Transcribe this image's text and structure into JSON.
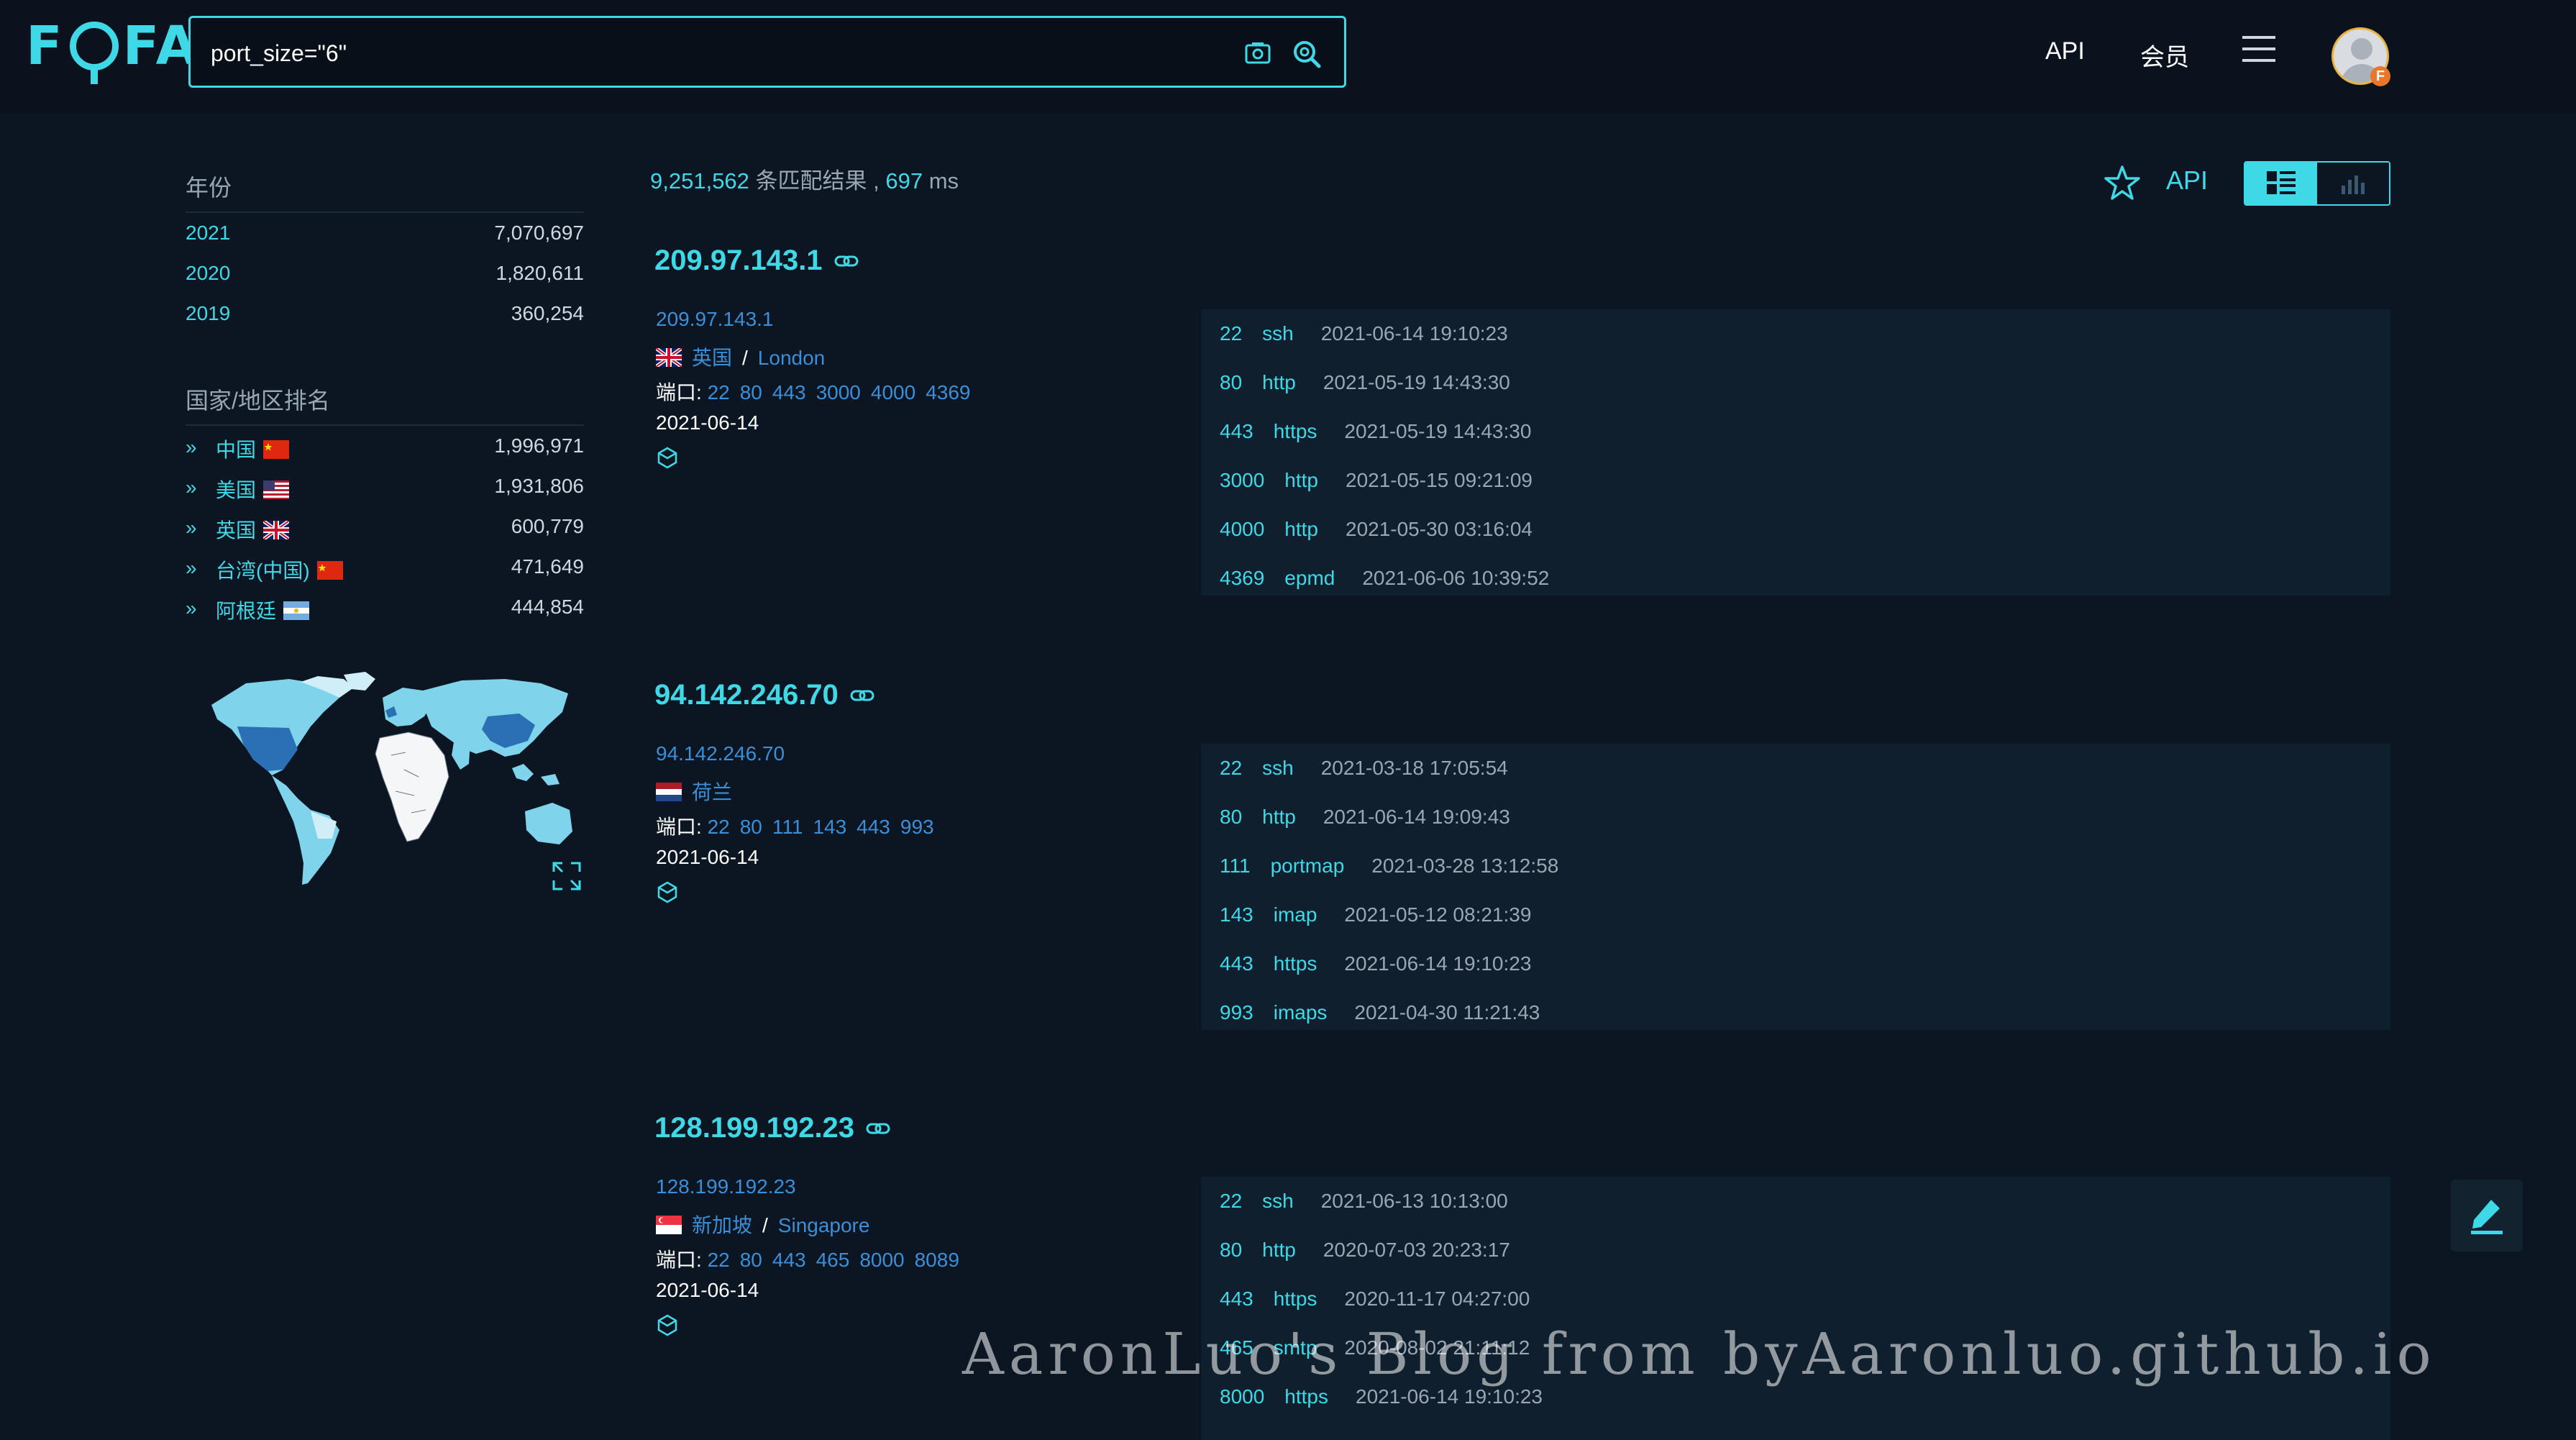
{
  "header": {
    "logo": "FOFA",
    "search_value": "port_size=\"6\"",
    "nav_api": "API",
    "nav_member": "会员",
    "avatar_badge": "F",
    "colors": {
      "accent": "#3fd8e6",
      "background": "#0b1622",
      "link": "#3a8fd8"
    }
  },
  "sidebar": {
    "year_title": "年份",
    "years": [
      {
        "label": "2021",
        "count": "7,070,697"
      },
      {
        "label": "2020",
        "count": "1,820,611"
      },
      {
        "label": "2019",
        "count": "360,254"
      }
    ],
    "country_title": "国家/地区排名",
    "countries": [
      {
        "label": "中国",
        "count": "1,996,971",
        "flag": "cn-flag-icon"
      },
      {
        "label": "美国",
        "count": "1,931,806",
        "flag": "us-flag-icon"
      },
      {
        "label": "英国",
        "count": "600,779",
        "flag": "uk-flag-icon"
      },
      {
        "label": "台湾(中国)",
        "count": "471,649",
        "flag": "cn-flag-icon"
      },
      {
        "label": "阿根廷",
        "count": "444,854",
        "flag": "ar-flag-icon"
      }
    ]
  },
  "summary": {
    "count": "9,251,562",
    "count_suffix": " 条匹配结果 , ",
    "ms": "697",
    "ms_unit": " ms"
  },
  "actions": {
    "api_label": "API"
  },
  "results": [
    {
      "title": "209.97.143.1",
      "ip": "209.97.143.1",
      "country": "英国",
      "city": "London",
      "ports_label": "端口: ",
      "ports": [
        "22",
        "80",
        "443",
        "3000",
        "4000",
        "4369"
      ],
      "date": "2021-06-14",
      "services": [
        {
          "port": "22",
          "protocol": "ssh",
          "time": "2021-06-14 19:10:23"
        },
        {
          "port": "80",
          "protocol": "http",
          "time": "2021-05-19 14:43:30"
        },
        {
          "port": "443",
          "protocol": "https",
          "time": "2021-05-19 14:43:30"
        },
        {
          "port": "3000",
          "protocol": "http",
          "time": "2021-05-15 09:21:09"
        },
        {
          "port": "4000",
          "protocol": "http",
          "time": "2021-05-30 03:16:04"
        },
        {
          "port": "4369",
          "protocol": "epmd",
          "time": "2021-06-06 10:39:52"
        }
      ]
    },
    {
      "title": "94.142.246.70",
      "ip": "94.142.246.70",
      "country": "荷兰",
      "city": "",
      "ports_label": "端口: ",
      "ports": [
        "22",
        "80",
        "111",
        "143",
        "443",
        "993"
      ],
      "date": "2021-06-14",
      "services": [
        {
          "port": "22",
          "protocol": "ssh",
          "time": "2021-03-18 17:05:54"
        },
        {
          "port": "80",
          "protocol": "http",
          "time": "2021-06-14 19:09:43"
        },
        {
          "port": "111",
          "protocol": "portmap",
          "time": "2021-03-28 13:12:58"
        },
        {
          "port": "143",
          "protocol": "imap",
          "time": "2021-05-12 08:21:39"
        },
        {
          "port": "443",
          "protocol": "https",
          "time": "2021-06-14 19:10:23"
        },
        {
          "port": "993",
          "protocol": "imaps",
          "time": "2021-04-30 11:21:43"
        }
      ]
    },
    {
      "title": "128.199.192.23",
      "ip": "128.199.192.23",
      "country": "新加坡",
      "city": "Singapore",
      "ports_label": "端口: ",
      "ports": [
        "22",
        "80",
        "443",
        "465",
        "8000",
        "8089"
      ],
      "date": "2021-06-14",
      "services": [
        {
          "port": "22",
          "protocol": "ssh",
          "time": "2021-06-13 10:13:00"
        },
        {
          "port": "80",
          "protocol": "http",
          "time": "2020-07-03 20:23:17"
        },
        {
          "port": "443",
          "protocol": "https",
          "time": "2020-11-17 04:27:00"
        },
        {
          "port": "465",
          "protocol": "smtp",
          "time": "2020-08-02 21:11:12"
        },
        {
          "port": "8000",
          "protocol": "https",
          "time": "2021-06-14 19:10:23"
        }
      ]
    }
  ],
  "watermark": "AaronLuo's Blog from byAaronluo.github.io"
}
